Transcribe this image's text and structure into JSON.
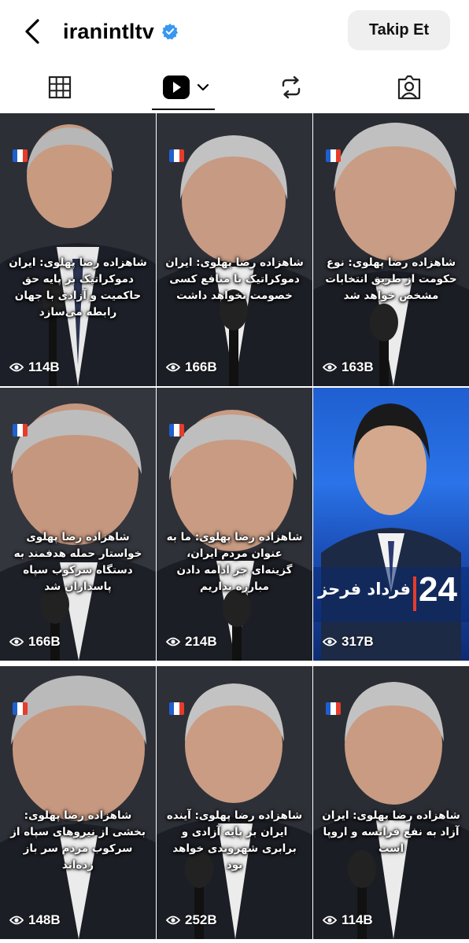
{
  "header": {
    "username": "iranintltv",
    "follow_label": "Takip Et"
  },
  "tabs": [
    {
      "name": "grid",
      "icon": "grid-icon"
    },
    {
      "name": "reels",
      "icon": "reels-icon",
      "selected": true
    },
    {
      "name": "reposts",
      "icon": "repost-icon"
    },
    {
      "name": "tagged",
      "icon": "tagged-user-icon"
    }
  ],
  "colors": {
    "accent_verified": "#3897f0",
    "follow_bg": "#efefef",
    "flag_blue": "#1f5fd0",
    "flag_white": "#ffffff",
    "flag_red": "#e63c2c"
  },
  "posts": [
    {
      "caption": "شاهزاده رضا پهلوی: ایران دموکراتیک بر پایه حق حاکمیت و آزادی با جهان رابطه می‌سازد",
      "views": "114B"
    },
    {
      "caption": "شاهزاده رضا پهلوی: ایران دموکراتیک با منافع کسی خصومت نخواهد داشت",
      "views": "166B"
    },
    {
      "caption": "شاهزاده رضا پهلوی: نوع حکومت از طریق انتخابات مشخص خواهد شد",
      "views": "163B"
    },
    {
      "caption": "شاهزاده رضا پهلوی خواستار حمله هدفمند به دستگاه سرکوب سپاه پاسداران شد",
      "views": "166B"
    },
    {
      "caption": "شاهزاده رضا پهلوی: ما به عنوان مردم ایران، گزینه‌ای جز ادامه دادن مبارزه نداریم",
      "views": "214B"
    },
    {
      "caption": "",
      "views": "317B",
      "news_channel": "24",
      "news_title": "فرداد فرحز"
    },
    {
      "caption": "شاهزاده رضا پهلوی: بخشی از نیروهای سپاه از سرکوب مردم سر باز زده‌اند",
      "views": "148B"
    },
    {
      "caption": "شاهزاده رضا پهلوی: آینده ایران بر پایه آزادی و برابری شهروندی خواهد بود",
      "views": "252B"
    },
    {
      "caption": "شاهزاده رضا پهلوی: ایران آزاد به نفع فرانسه و اروپا است",
      "views": "114B"
    }
  ]
}
